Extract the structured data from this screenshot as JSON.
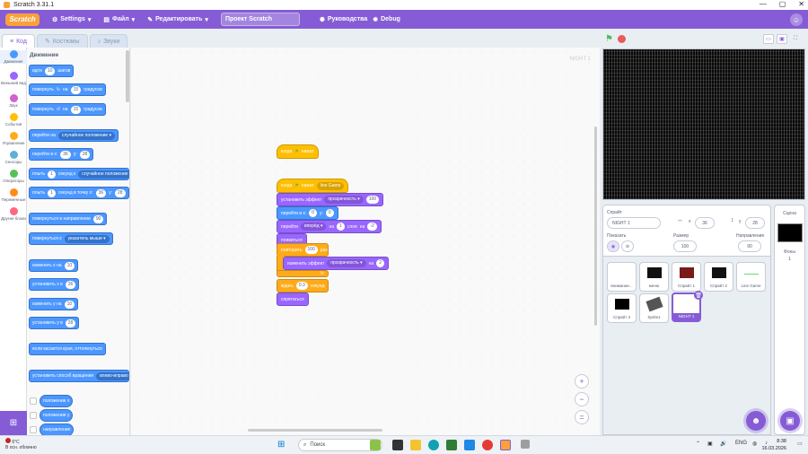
{
  "window": {
    "title": "Scratch 3.31.1",
    "controls": [
      "—",
      "▢",
      "✕"
    ]
  },
  "menubar": {
    "logo": "Scratch",
    "settings": "Settings",
    "file": "Файл",
    "edit": "Редактировать",
    "project_title": "Проект Scratch",
    "tutorials": "Руководства",
    "debug": "Debug"
  },
  "tabs": {
    "code": "Код",
    "costumes": "Костюмы",
    "sounds": "Звуки"
  },
  "categories": [
    {
      "label": "Движение",
      "color": "#4c97ff"
    },
    {
      "label": "Внешний вид",
      "color": "#9966ff"
    },
    {
      "label": "Звук",
      "color": "#cf63cf"
    },
    {
      "label": "События",
      "color": "#ffbf00"
    },
    {
      "label": "Управление",
      "color": "#ffab19"
    },
    {
      "label": "Сенсоры",
      "color": "#5cb1d6"
    },
    {
      "label": "Операторы",
      "color": "#59c059"
    },
    {
      "label": "Переменные",
      "color": "#ff8c1a"
    },
    {
      "label": "Другие блоки",
      "color": "#ff6680"
    }
  ],
  "palette": {
    "title": "Движение",
    "move": {
      "a": "идти",
      "n": "10",
      "b": "шагов"
    },
    "turn_right": {
      "a": "повернуть",
      "b": "на",
      "n": "15",
      "c": "градусов"
    },
    "turn_left": {
      "a": "повернуть",
      "b": "на",
      "n": "15",
      "c": "градусов"
    },
    "goto": {
      "a": "перейти на",
      "dd": "случайное положение"
    },
    "goto_xy": {
      "a": "перейти в x:",
      "x": "36",
      "b": "y:",
      "y": "28"
    },
    "glide": {
      "a": "плыть",
      "n": "1",
      "b": "секунд к",
      "dd": "случайное положение"
    },
    "glide_xy": {
      "a": "плыть",
      "n": "1",
      "b": "секунд в точку x:",
      "x": "36",
      "c": "y:",
      "y": "28"
    },
    "point_dir": {
      "a": "повернуться в направлении",
      "n": "90"
    },
    "point_to": {
      "a": "повернуться к",
      "dd": "указатель мыши"
    },
    "change_x": {
      "a": "изменить х на",
      "n": "10"
    },
    "set_x": {
      "a": "установить х в",
      "n": "36"
    },
    "change_y": {
      "a": "изменить у на",
      "n": "10"
    },
    "set_y": {
      "a": "установить у в",
      "n": "28"
    },
    "bounce": "если касается края, оттолкнуться",
    "rotation": {
      "a": "установить способ вращения",
      "dd": "влево-вправо"
    },
    "rep_x": "положение x",
    "rep_y": "положение y",
    "rep_dir": "направление"
  },
  "workspace": {
    "sprite_watermark": "NIGHT 1",
    "script1": {
      "hat": "когда",
      "flag": "⚑",
      "hat_b": "нажат"
    },
    "script2": {
      "hat": "когда",
      "hat_b": "нажат",
      "hat_dd": "line Game",
      "effect": {
        "a": "установить эффект",
        "dd": "прозрачность",
        "n": "100"
      },
      "goto": {
        "a": "перейти в x:",
        "x": "0",
        "b": "y:",
        "y": "0"
      },
      "layer": {
        "a": "перейти",
        "dd": "вперёд",
        "b": "на",
        "n": "1",
        "c": "слоя",
        "d": "на",
        "dn": "-2"
      },
      "show": "появиться",
      "repeat": {
        "a": "повторить",
        "n": "100",
        "b": "раз"
      },
      "change_effect": {
        "a": "изменить эффект",
        "dd": "прозрачность",
        "b": "на",
        "n": "2"
      },
      "wait": {
        "a": "ждать",
        "n": "0.3",
        "b": "секунд"
      },
      "hide": "спрятаться"
    },
    "zoom_in": "+",
    "zoom_out": "−",
    "zoom_reset": "="
  },
  "sprite_info": {
    "sprite_label": "Спрайт",
    "sprite_name": "NIGHT 1",
    "x_label": "x",
    "x": "36",
    "y_label": "y",
    "y": "28",
    "show_label": "Показать",
    "size_label": "Размер",
    "size": "100",
    "dir_label": "Направление",
    "dir": "90"
  },
  "stage_pane": {
    "title": "Сцена",
    "backdrops_label": "Фоны",
    "backdrops": "1"
  },
  "sprites": [
    {
      "name": "внимание...",
      "thumb": "#ffffff"
    },
    {
      "name": "меню",
      "thumb": "#111111"
    },
    {
      "name": "Спрайт 1",
      "thumb": "#7a1a1a"
    },
    {
      "name": "Спрайт 2",
      "thumb": "#111111"
    },
    {
      "name": "Line Game",
      "thumb": "#66dd66"
    },
    {
      "name": "Спрайт 3",
      "thumb": "#000000"
    },
    {
      "name": "Sprite1",
      "thumb": "#555555"
    },
    {
      "name": "NIGHT 1",
      "thumb": "#ffffff"
    }
  ],
  "taskbar": {
    "weather_temp": "6°C",
    "weather_desc": "В осн. облачно",
    "search": "Поиск",
    "lang": "ENG",
    "time": "8:38",
    "date": "16.03.2026"
  }
}
